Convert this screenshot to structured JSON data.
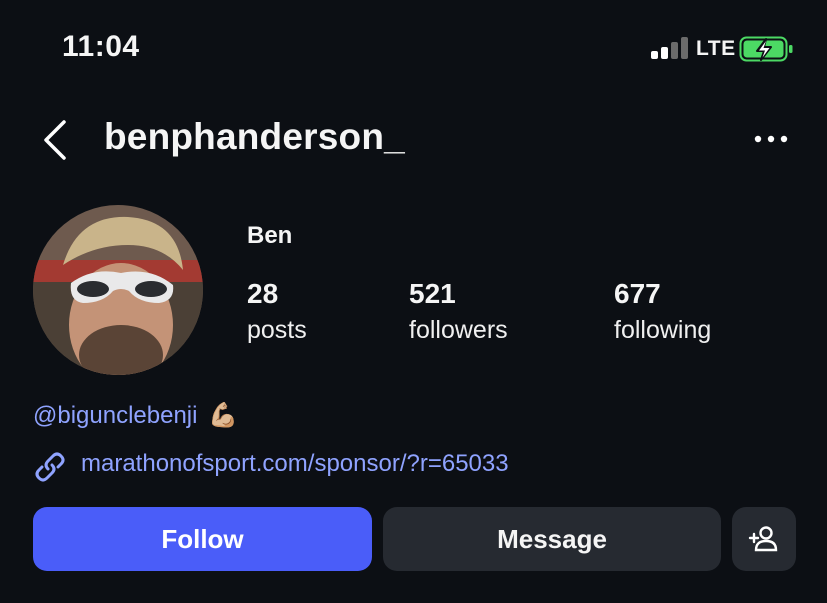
{
  "status_bar": {
    "time": "11:04",
    "network": "LTE",
    "battery_icon": "battery-charging-icon",
    "signal_icon": "cellular-signal-icon",
    "colors": {
      "battery_fill": "#4cd964"
    }
  },
  "header": {
    "username": "benphanderson_",
    "back_icon": "chevron-left-icon",
    "more_icon": "more-horizontal-icon"
  },
  "profile": {
    "display_name": "Ben",
    "stats": [
      {
        "value": "28",
        "label": "posts"
      },
      {
        "value": "521",
        "label": "followers"
      },
      {
        "value": "677",
        "label": "following"
      }
    ],
    "bio": {
      "mention": "@bigunclebenji",
      "emoji": "💪🏼"
    },
    "link": {
      "text": "marathonofsport.com/sponsor/?r=65033",
      "icon": "link-icon"
    }
  },
  "actions": {
    "follow_label": "Follow",
    "message_label": "Message",
    "add_person_icon": "add-person-icon"
  },
  "colors": {
    "background": "#0c0f14",
    "accent_button": "#4a5df9",
    "secondary_button": "#262a31",
    "link": "#8fa3ff"
  }
}
